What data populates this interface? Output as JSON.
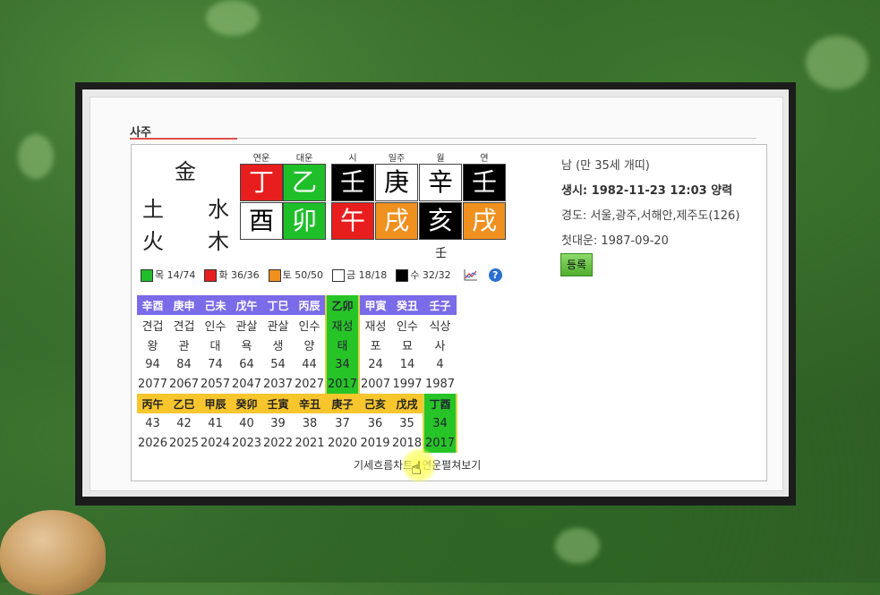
{
  "section": {
    "title": "사주"
  },
  "elements": {
    "metal": "金",
    "earth": "土",
    "water": "水",
    "fire": "火",
    "wood": "木"
  },
  "pillar_labels": [
    "연운",
    "대운",
    "시",
    "일주",
    "월",
    "연"
  ],
  "pillars_top": [
    "丁",
    "乙",
    "壬",
    "庚",
    "辛",
    "壬"
  ],
  "pillars_bottom": [
    "酉",
    "卯",
    "午",
    "戌",
    "亥",
    "戌"
  ],
  "hidden_stem": "壬",
  "legend": {
    "wood": "목 14/74",
    "fire": "화 36/36",
    "earth": "토 50/50",
    "metal": "금 18/18",
    "water": "수 32/32",
    "help": "?"
  },
  "info": {
    "gender_age": "남 (만 35세 개띠)",
    "birth": "생시: 1982-11-23 12:03 양력",
    "longitude": "경도: 서울,광주,서해안,제주도(126)",
    "first_daeun": "첫대운: 1987-09-20",
    "register": "등록"
  },
  "daeun_table": {
    "pillars": [
      "辛酉",
      "庚申",
      "己未",
      "戊午",
      "丁巳",
      "丙辰",
      "乙卯",
      "甲寅",
      "癸丑",
      "壬子"
    ],
    "tengod": [
      "견겁",
      "견겁",
      "인수",
      "관살",
      "관살",
      "인수",
      "재성",
      "재성",
      "인수",
      "식상"
    ],
    "stage": [
      "왕",
      "관",
      "대",
      "욕",
      "생",
      "양",
      "태",
      "포",
      "묘",
      "사"
    ],
    "ages": [
      "94",
      "84",
      "74",
      "64",
      "54",
      "44",
      "34",
      "24",
      "14",
      "4"
    ],
    "years": [
      "2077",
      "2067",
      "2057",
      "2047",
      "2037",
      "2027",
      "2017",
      "2007",
      "1997",
      "1987"
    ]
  },
  "year_table": {
    "pillars": [
      "丙午",
      "乙巳",
      "甲辰",
      "癸卯",
      "壬寅",
      "辛丑",
      "庚子",
      "己亥",
      "戊戌",
      "丁酉"
    ],
    "ages": [
      "43",
      "42",
      "41",
      "40",
      "39",
      "38",
      "37",
      "36",
      "35",
      "34"
    ],
    "years": [
      "2026",
      "2025",
      "2024",
      "2023",
      "2022",
      "2021",
      "2020",
      "2019",
      "2018",
      "2017"
    ]
  },
  "links": {
    "flow_chart": "기세흐름차트",
    "year_view": "연운펼쳐보기"
  },
  "colors": {
    "wood": "#1fbf2a",
    "fire": "#e81e1e",
    "earth": "#f0901e",
    "metal": "#ffffff",
    "water": "#000000",
    "purple_header": "#7a6be8",
    "yellow_header": "#f7c62d",
    "highlight": "#27c427"
  }
}
